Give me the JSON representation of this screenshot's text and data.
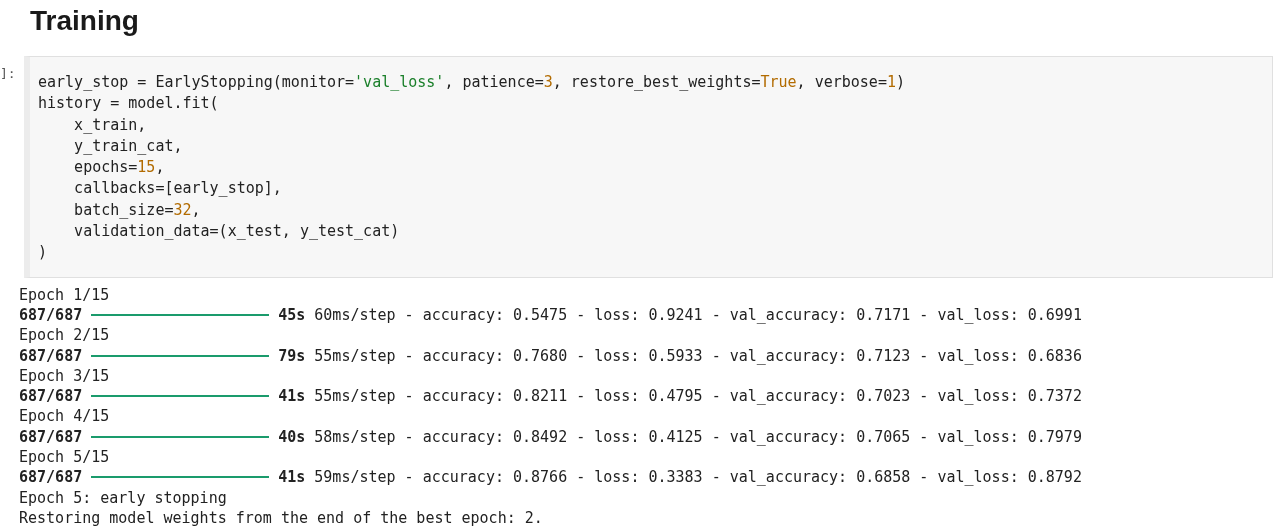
{
  "heading": "Training",
  "cell": {
    "prompt": "]:",
    "code_lines": [
      [
        {
          "text": "early_stop = EarlyStopping(monitor=",
          "kind": "plain"
        },
        {
          "text": "'val_loss'",
          "kind": "string"
        },
        {
          "text": ", patience=",
          "kind": "plain"
        },
        {
          "text": "3",
          "kind": "number"
        },
        {
          "text": ", restore_best_weights=",
          "kind": "plain"
        },
        {
          "text": "True",
          "kind": "number"
        },
        {
          "text": ", verbose=",
          "kind": "plain"
        },
        {
          "text": "1",
          "kind": "number"
        },
        {
          "text": ")",
          "kind": "plain"
        }
      ],
      [
        {
          "text": "history = model.fit(",
          "kind": "plain"
        }
      ],
      [
        {
          "text": "    x_train,",
          "kind": "plain"
        }
      ],
      [
        {
          "text": "    y_train_cat,",
          "kind": "plain"
        }
      ],
      [
        {
          "text": "    epochs=",
          "kind": "plain"
        },
        {
          "text": "15",
          "kind": "number"
        },
        {
          "text": ",",
          "kind": "plain"
        }
      ],
      [
        {
          "text": "    callbacks=[early_stop],",
          "kind": "plain"
        }
      ],
      [
        {
          "text": "    batch_size=",
          "kind": "plain"
        },
        {
          "text": "32",
          "kind": "number"
        },
        {
          "text": ",",
          "kind": "plain"
        }
      ],
      [
        {
          "text": "    validation_data=(x_test, y_test_cat)",
          "kind": "plain"
        }
      ],
      [
        {
          "text": ")",
          "kind": "plain"
        }
      ]
    ]
  },
  "output": [
    {
      "kind": "text",
      "text": "Epoch 1/15"
    },
    {
      "kind": "progress",
      "steps": "687/687",
      "level": 1,
      "time": "45s",
      "metrics": "60ms/step - accuracy: 0.5475 - loss: 0.9241 - val_accuracy: 0.7171 - val_loss: 0.6991"
    },
    {
      "kind": "text",
      "text": "Epoch 2/15"
    },
    {
      "kind": "progress",
      "steps": "687/687",
      "level": 1,
      "time": "79s",
      "metrics": "55ms/step - accuracy: 0.7680 - loss: 0.5933 - val_accuracy: 0.7123 - val_loss: 0.6836"
    },
    {
      "kind": "text",
      "text": "Epoch 3/15"
    },
    {
      "kind": "progress",
      "steps": "687/687",
      "level": 1,
      "time": "41s",
      "metrics": "55ms/step - accuracy: 0.8211 - loss: 0.4795 - val_accuracy: 0.7023 - val_loss: 0.7372"
    },
    {
      "kind": "text",
      "text": "Epoch 4/15"
    },
    {
      "kind": "progress",
      "steps": "687/687",
      "level": 1,
      "time": "40s",
      "metrics": "58ms/step - accuracy: 0.8492 - loss: 0.4125 - val_accuracy: 0.7065 - val_loss: 0.7979"
    },
    {
      "kind": "text",
      "text": "Epoch 5/15"
    },
    {
      "kind": "progress",
      "steps": "687/687",
      "level": 1,
      "time": "41s",
      "metrics": "59ms/step - accuracy: 0.8766 - loss: 0.3383 - val_accuracy: 0.6858 - val_loss: 0.8792"
    },
    {
      "kind": "text",
      "text": "Epoch 5: early stopping"
    },
    {
      "kind": "text",
      "text": "Restoring model weights from the end of the best epoch: 2."
    }
  ]
}
